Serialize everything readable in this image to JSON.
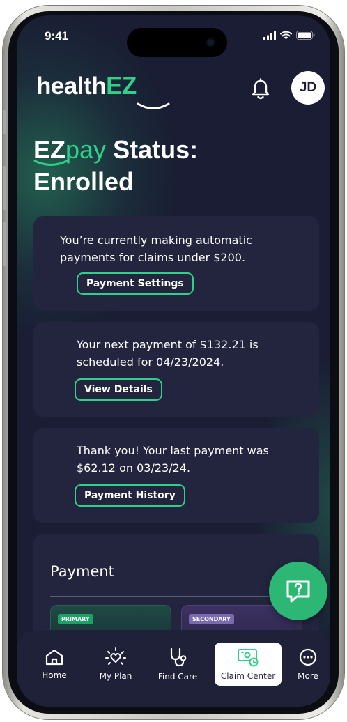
{
  "status_bar": {
    "time": "9:41"
  },
  "header": {
    "logo_main": "health",
    "logo_accent": "EZ",
    "avatar_initials": "JD"
  },
  "status": {
    "brand_ez": "EZ",
    "brand_pay": "pay",
    "title_rest": "Status:",
    "title_line2": "Enrolled"
  },
  "cards": [
    {
      "text_line1": "You’re currently making automatic",
      "text_line2": "payments for claims under $200.",
      "button": "Payment Settings"
    },
    {
      "text_line1": "Your next payment of $132.21 is",
      "text_line2": "scheduled for 04/23/2024.",
      "button": "View Details"
    },
    {
      "text_line1": "Thank you! Your last payment was",
      "text_line2": "$62.12 on 03/23/24.",
      "button": "Payment History"
    }
  ],
  "payment": {
    "title": "Payment",
    "primary_tag": "PRIMARY",
    "secondary_tag": "SECONDARY"
  },
  "tabs": [
    {
      "label": "Home",
      "icon": "home-icon"
    },
    {
      "label": "My Plan",
      "icon": "heart-sparkle-icon"
    },
    {
      "label": "Find Care",
      "icon": "stethoscope-icon"
    },
    {
      "label": "Claim Center",
      "icon": "claim-icon",
      "active": true
    },
    {
      "label": "More",
      "icon": "more-icon"
    }
  ],
  "colors": {
    "accent": "#2fd08a",
    "background": "#1a1d33",
    "card": "#22253d",
    "fab": "#2db775"
  }
}
